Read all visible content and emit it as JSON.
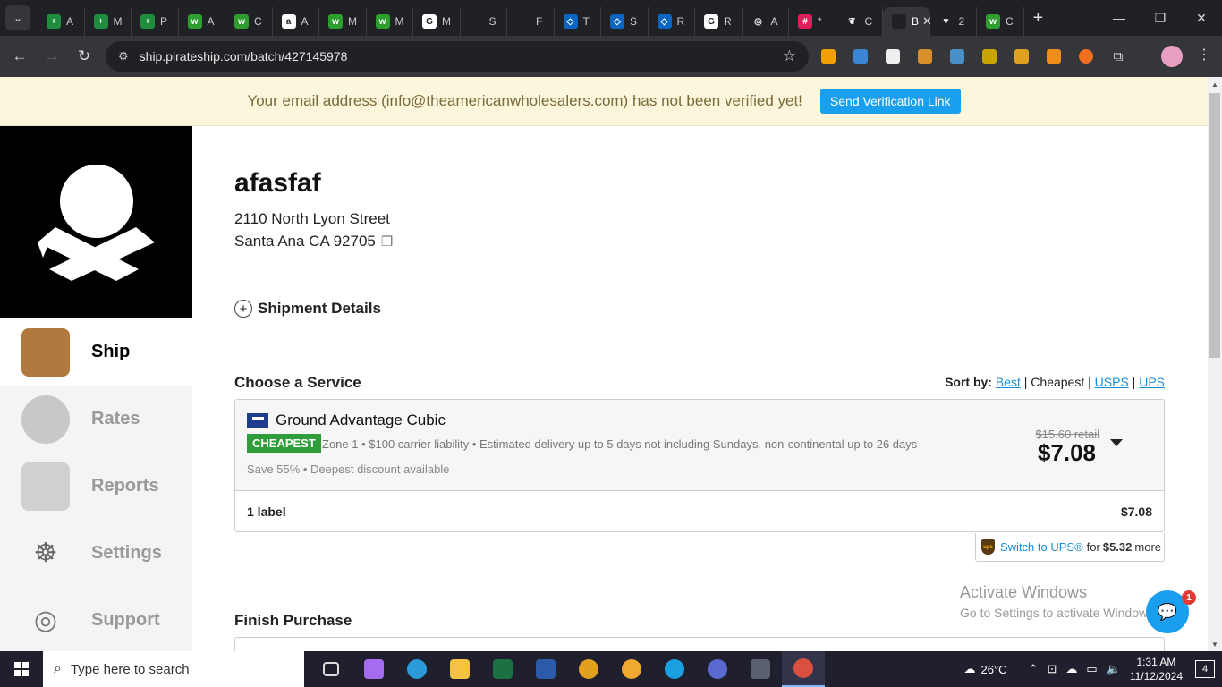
{
  "browser": {
    "tabs": [
      {
        "label": "A",
        "icon_color": "#1e8e3e",
        "icon": "+"
      },
      {
        "label": "M",
        "icon_color": "#1e8e3e",
        "icon": "+"
      },
      {
        "label": "P",
        "icon_color": "#1e8e3e",
        "icon": "+"
      },
      {
        "label": "A",
        "icon_color": "#2e9f2e",
        "icon": "w"
      },
      {
        "label": "C",
        "icon_color": "#2e9f2e",
        "icon": "w"
      },
      {
        "label": "A",
        "icon_color": "#ffffff",
        "icon": "a"
      },
      {
        "label": "M",
        "icon_color": "#2e9f2e",
        "icon": "w"
      },
      {
        "label": "M",
        "icon_color": "#2e9f2e",
        "icon": "w"
      },
      {
        "label": "M",
        "icon_color": "#ffffff",
        "icon": "G"
      },
      {
        "label": "S",
        "icon_color": "#202124",
        "icon": ""
      },
      {
        "label": "F",
        "icon_color": "#202124",
        "icon": ""
      },
      {
        "label": "T",
        "icon_color": "#0a66c2",
        "icon": "◇"
      },
      {
        "label": "S",
        "icon_color": "#0a66c2",
        "icon": "◇"
      },
      {
        "label": "R",
        "icon_color": "#0a66c2",
        "icon": "◇"
      },
      {
        "label": "R",
        "icon_color": "#ffffff",
        "icon": "G"
      },
      {
        "label": "A",
        "icon_color": "#202124",
        "icon": "◎"
      },
      {
        "label": "*",
        "icon_color": "#e01e5a",
        "icon": "#"
      },
      {
        "label": "C",
        "icon_color": "#202124",
        "icon": "❦"
      },
      {
        "label": "B",
        "icon_color": "#202124",
        "icon": "",
        "active": true
      },
      {
        "label": "2",
        "icon_color": "#202124",
        "icon": "▼"
      },
      {
        "label": "C",
        "icon_color": "#2e9f2e",
        "icon": "w"
      }
    ],
    "url": "ship.pirateship.com/batch/427145978"
  },
  "banner": {
    "message": "Your email address (info@theamericanwholesalers.com) has not been verified yet!",
    "button": "Send Verification Link"
  },
  "sidebar": {
    "items": [
      {
        "label": "Ship",
        "icon": "box-icon",
        "active": true
      },
      {
        "label": "Rates",
        "icon": "coins-icon"
      },
      {
        "label": "Reports",
        "icon": "book-icon"
      },
      {
        "label": "Settings",
        "icon": "ship-wheel-icon"
      },
      {
        "label": "Support",
        "icon": "life-ring-icon"
      }
    ]
  },
  "recipient": {
    "name": "afasfaf",
    "street": "2110 North Lyon Street",
    "city_line": "Santa Ana CA 92705"
  },
  "shipment_details": "Shipment Details",
  "choose_service": {
    "title": "Choose a Service",
    "sort_label": "Sort by:",
    "sort_options": [
      "Best",
      "Cheapest",
      "USPS",
      "UPS"
    ],
    "service": {
      "name": "Ground Advantage Cubic",
      "badge": "CHEAPEST",
      "description": "Zone 1 • $100 carrier liability • Estimated delivery up to 5 days not including Sundays, non-continental up to 26 days",
      "savings": "Save 55% • Deepest discount available",
      "retail": "$15.60 retail",
      "price": "$7.08"
    },
    "summary": {
      "labels": "1 label",
      "total": "$7.08"
    },
    "switch": {
      "link": "Switch to UPS®",
      "for": "for",
      "amount": "$5.32",
      "more": "more"
    }
  },
  "finish_purchase": "Finish Purchase",
  "watermark": {
    "title": "Activate Windows",
    "subtitle": "Go to Settings to activate Windows."
  },
  "chat": {
    "badge": "1"
  },
  "taskbar": {
    "search_placeholder": "Type here to search",
    "weather": "26°C",
    "time": "1:31 AM",
    "date": "11/12/2024",
    "notifications": "4"
  }
}
